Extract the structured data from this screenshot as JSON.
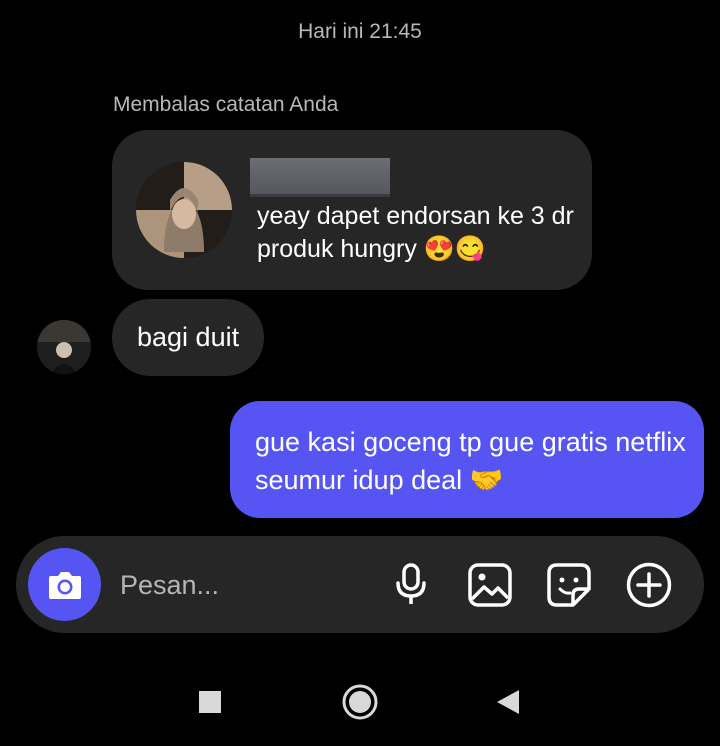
{
  "thread": {
    "timestamp": "Hari ini 21:45",
    "reply_caption": "Membalas catatan Anda",
    "note": {
      "text": "yeay dapet endorsan ke 3 dr produk hungry 😍😋",
      "author_redacted": true
    },
    "messages": [
      {
        "direction": "incoming",
        "text": "bagi duit"
      },
      {
        "direction": "outgoing",
        "text": "gue kasi goceng tp gue gratis netflix seumur idup deal 🤝"
      }
    ]
  },
  "composer": {
    "placeholder": "Pesan...",
    "value": "",
    "icons": [
      "camera-icon",
      "microphone-icon",
      "gallery-icon",
      "sticker-icon",
      "add-icon"
    ]
  },
  "navbar": {
    "icons": [
      "recents-square-icon",
      "home-circle-icon",
      "back-triangle-icon"
    ]
  },
  "colors": {
    "background": "#000000",
    "bubble_incoming": "#262626",
    "bubble_outgoing": "#5655f4",
    "secondary_text": "#b8b8b8"
  }
}
